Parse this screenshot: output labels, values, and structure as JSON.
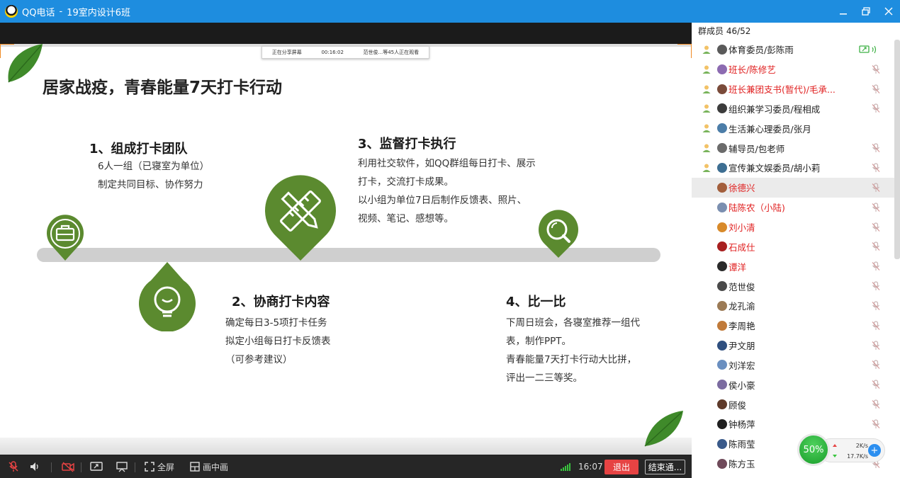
{
  "window": {
    "app_name": "QQ电话",
    "separator": "-",
    "group_name": "19室内设计6班",
    "controls": [
      "minimize",
      "maximize",
      "close"
    ]
  },
  "share_bar": {
    "status": "正在分享屏幕",
    "duration": "00:16:02",
    "viewers": "范世俊...等45人正在观看"
  },
  "slide": {
    "title": "居家战疫，青春能量7天打卡行动",
    "steps": [
      {
        "heading": "1、组成打卡团队",
        "lines": [
          "6人一组（已寝室为单位）",
          "制定共同目标、协作努力"
        ],
        "icon": "briefcase-icon"
      },
      {
        "heading": "2、协商打卡内容",
        "lines": [
          "确定每日3-5项打卡任务",
          "拟定小组每日打卡反馈表",
          "（可参考建议）"
        ],
        "icon": "lightbulb-icon"
      },
      {
        "heading": "3、监督打卡执行",
        "lines": [
          "利用社交软件，如QQ群组每日打卡、展示",
          "打卡，交流打卡成果。",
          "以小组为单位7日后制作反馈表、照片、",
          "视频、笔记、感想等。"
        ],
        "icon": "pencil-ruler-icon"
      },
      {
        "heading": "4、比一比",
        "lines": [
          "下周日班会，各寝室推荐一组代",
          "表，制作PPT。",
          "青春能量7天打卡行动大比拼，",
          "评出一二三等奖。"
        ],
        "icon": "magnifier-icon"
      }
    ],
    "accent_color": "#5b8a2f"
  },
  "panel": {
    "header": "群成员 46/52",
    "members": [
      {
        "name": "体育委员/彭陈雨",
        "role": "admin",
        "red": false,
        "status": "sharing"
      },
      {
        "name": "班长/陈修艺",
        "role": "admin",
        "red": true,
        "status": "muted"
      },
      {
        "name": "班长兼团支书(暂代)/毛承...",
        "role": "admin",
        "red": true,
        "status": "muted"
      },
      {
        "name": "组织兼学习委员/程相成",
        "role": "admin",
        "red": false,
        "status": "muted"
      },
      {
        "name": "生活兼心理委员/张月",
        "role": "admin",
        "red": false,
        "status": "none"
      },
      {
        "name": "辅导员/包老师",
        "role": "admin",
        "red": false,
        "status": "muted"
      },
      {
        "name": "宣传兼文娱委员/胡小莉",
        "role": "admin",
        "red": false,
        "status": "muted"
      },
      {
        "name": "徐德兴",
        "role": "member",
        "red": true,
        "status": "muted",
        "selected": true
      },
      {
        "name": "陆陈农（小陆)",
        "role": "member",
        "red": true,
        "status": "muted"
      },
      {
        "name": "刘小清",
        "role": "member",
        "red": true,
        "status": "muted"
      },
      {
        "name": "石成仕",
        "role": "member",
        "red": true,
        "status": "muted"
      },
      {
        "name": "谭洋",
        "role": "member",
        "red": true,
        "status": "muted"
      },
      {
        "name": "范世俊",
        "role": "member",
        "red": false,
        "status": "muted"
      },
      {
        "name": "龙孔渝",
        "role": "member",
        "red": false,
        "status": "muted"
      },
      {
        "name": "李周艳",
        "role": "member",
        "red": false,
        "status": "muted"
      },
      {
        "name": "尹文朋",
        "role": "member",
        "red": false,
        "status": "muted"
      },
      {
        "name": "刘洋宏",
        "role": "member",
        "red": false,
        "status": "muted"
      },
      {
        "name": "侯小豪",
        "role": "member",
        "red": false,
        "status": "muted"
      },
      {
        "name": "顾俊",
        "role": "member",
        "red": false,
        "status": "muted"
      },
      {
        "name": "钟杨萍",
        "role": "member",
        "red": false,
        "status": "muted"
      },
      {
        "name": "陈雨莹",
        "role": "member",
        "red": false,
        "status": "muted"
      },
      {
        "name": "陈方玉",
        "role": "member",
        "red": false,
        "status": "muted"
      }
    ]
  },
  "network": {
    "percent": "50%",
    "upload": "2K/s",
    "download": "17.7K/s"
  },
  "toolbar": {
    "fullscreen": "全屏",
    "pip": "画中画",
    "time": "16:07",
    "exit": "退出",
    "end_call": "结束通..."
  }
}
